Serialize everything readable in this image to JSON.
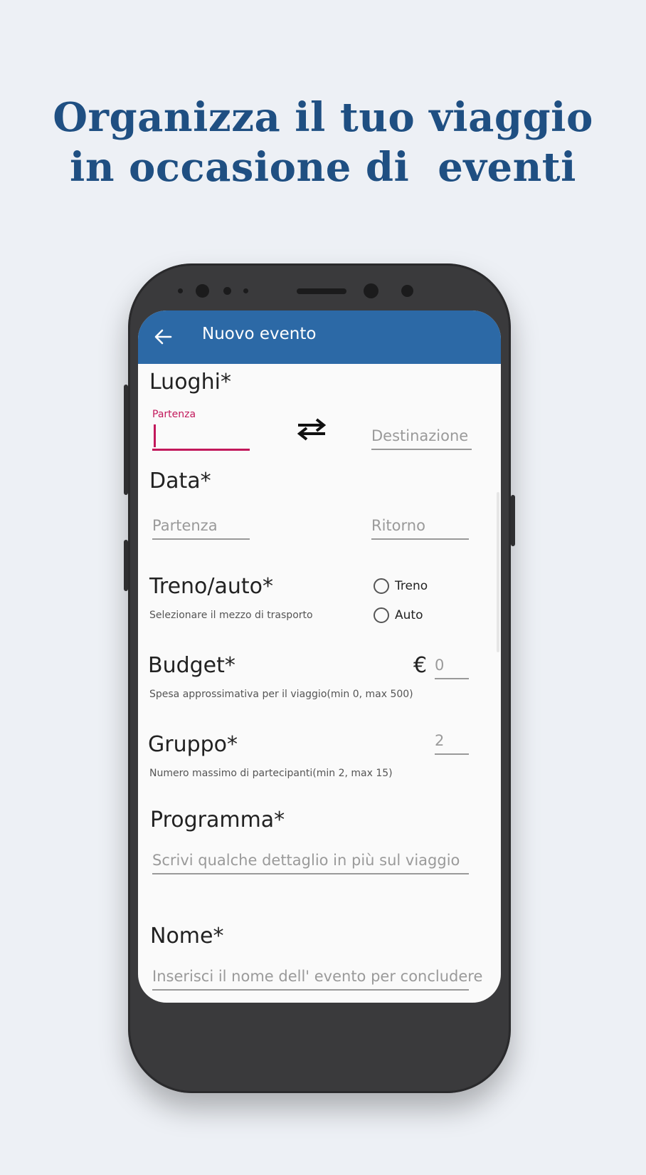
{
  "headline": {
    "line1": "Organizza il tuo viaggio",
    "line2": "in occasione di  eventi"
  },
  "appbar": {
    "title": "Nuovo evento",
    "back_icon": "arrow-left-icon"
  },
  "form": {
    "luoghi": {
      "heading": "Luoghi*",
      "departure_label": "Partenza",
      "departure_value": "",
      "swap_icon": "swap-arrows-icon",
      "destination_placeholder": "Destinazione"
    },
    "data": {
      "heading": "Data*",
      "departure_placeholder": "Partenza",
      "return_placeholder": "Ritorno"
    },
    "transport": {
      "heading": "Treno/auto*",
      "hint": "Selezionare il mezzo di trasporto",
      "options": [
        "Treno",
        "Auto"
      ]
    },
    "budget": {
      "heading": "Budget*",
      "hint": "Spesa approssimativa per il viaggio(min 0, max 500)",
      "currency": "€",
      "placeholder": "0"
    },
    "gruppo": {
      "heading": "Gruppo*",
      "hint": "Numero massimo di partecipanti(min 2, max 15)",
      "placeholder": "2"
    },
    "programma": {
      "heading": "Programma*",
      "placeholder": "Scrivi qualche dettaglio in più sul viaggio"
    },
    "nome": {
      "heading": "Nome*",
      "placeholder": "Inserisci il nome dell' evento per concludere"
    }
  },
  "colors": {
    "background": "#edf0f5",
    "headline": "#1f4f82",
    "appbar": "#2c69a6",
    "accent": "#c2185b"
  }
}
